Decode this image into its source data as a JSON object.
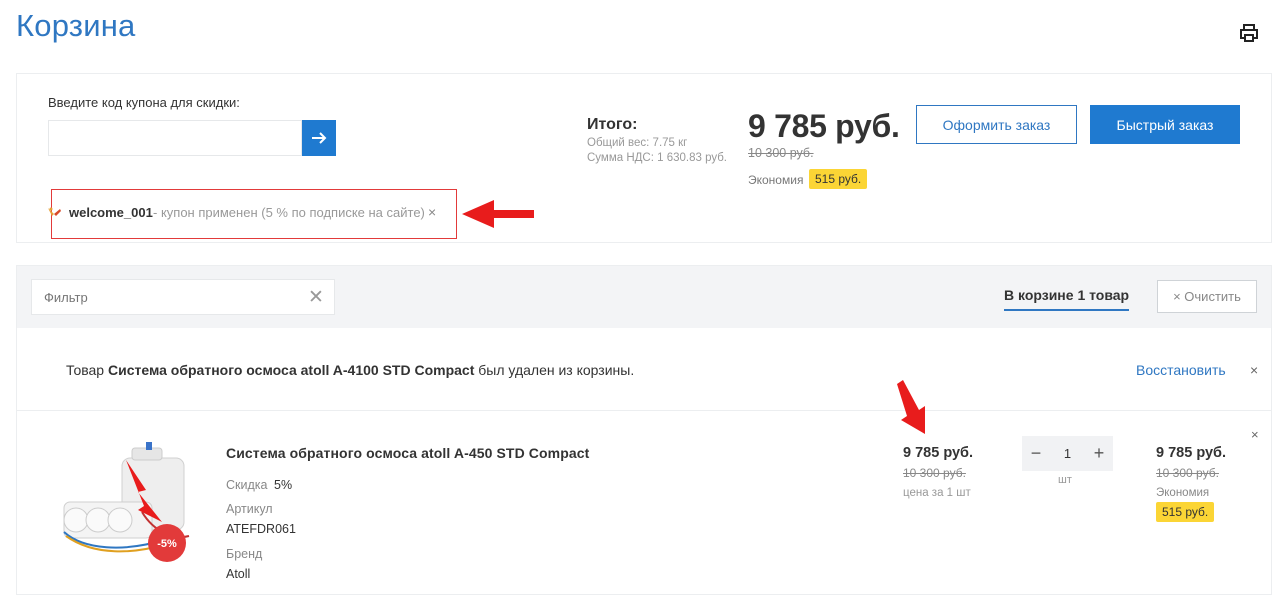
{
  "page": {
    "title": "Корзина"
  },
  "coupon": {
    "label": "Введите код купона для скидки:",
    "input_value": "",
    "applied_code": "welcome_001",
    "applied_note": "- купон применен (5 % по подписке на сайте)",
    "remove": "×"
  },
  "summary": {
    "heading": "Итого:",
    "weight": "Общий вес: 7.75 кг",
    "vat": "Сумма НДС: 1 630.83 руб.",
    "total": "9 785 руб.",
    "old_total": "10 300 руб.",
    "economy_label": "Экономия",
    "economy_value": "515 руб.",
    "checkout_label": "Оформить заказ",
    "quick_order_label": "Быстрый заказ"
  },
  "cart": {
    "filter_placeholder": "Фильтр",
    "filter_clear": "✕",
    "count_label": "В корзине 1 товар",
    "clear_label": "× Очистить"
  },
  "removed": {
    "prefix": "Товар ",
    "product": "Система обратного осмоса atoll A-4100 STD Compact",
    "suffix": " был удален из корзины.",
    "restore": "Восстановить",
    "close": "×"
  },
  "item": {
    "name": "Система обратного осмоса atoll A-450 STD Compact",
    "discount_label": "Скидка",
    "discount_value": "5%",
    "sku_label": "Артикул",
    "sku": "ATEFDR061",
    "brand_label": "Бренд",
    "brand": "Atoll",
    "badge": "-5%",
    "price": "9 785 руб.",
    "old_price": "10 300 руб.",
    "price_note": "цена за 1 шт",
    "qty_minus": "−",
    "qty": "1",
    "qty_plus": "+",
    "qty_unit": "шт",
    "sum": "9 785 руб.",
    "sum_old": "10 300 руб.",
    "sum_economy_label": "Экономия",
    "sum_economy": "515 руб.",
    "close": "×"
  },
  "colors": {
    "accent": "#1f7ad0",
    "title": "#2f77c2",
    "badge": "#fbd535",
    "annotation": "#e23a3a"
  }
}
